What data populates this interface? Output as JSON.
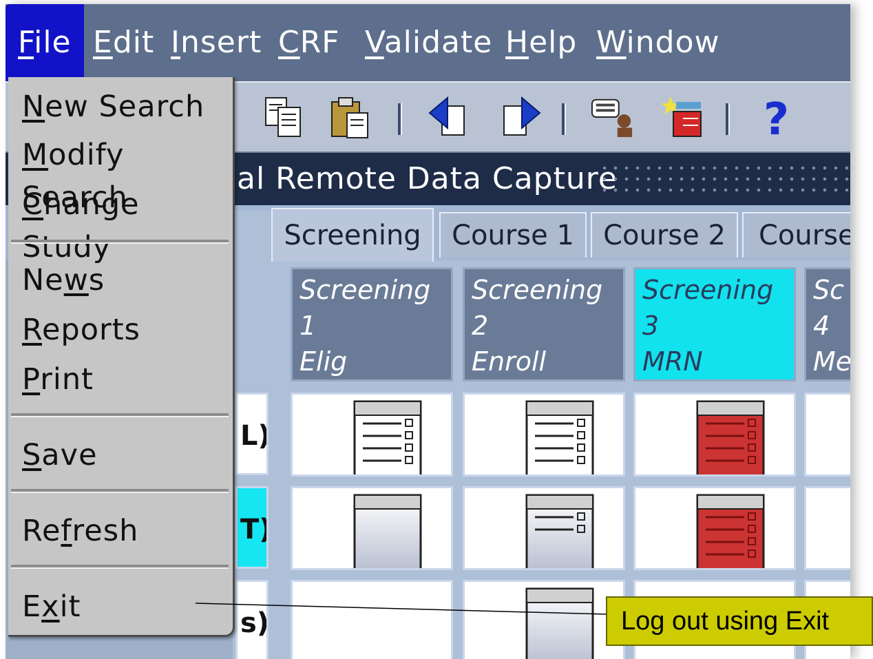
{
  "menubar": {
    "items": [
      "File",
      "Edit",
      "Insert",
      "CRF",
      "Validate",
      "Help",
      "Window"
    ],
    "active": "File"
  },
  "toolbar": {
    "icons": [
      "copy-icon",
      "paste-icon",
      "back-arrow-icon",
      "forward-arrow-icon",
      "comment-person-icon",
      "checklist-star-icon",
      "help-icon"
    ]
  },
  "title": {
    "text": "al Remote Data Capture"
  },
  "tabs": [
    "Screening",
    "Course 1",
    "Course 2",
    "Course"
  ],
  "selected_tab": "Screening",
  "columns": [
    {
      "line1": "Screening",
      "line2": "1",
      "line3": "Elig",
      "highlight": false
    },
    {
      "line1": "Screening",
      "line2": "2",
      "line3": "Enroll",
      "highlight": false
    },
    {
      "line1": "Screening",
      "line2": "3",
      "line3": "MRN",
      "highlight": true
    },
    {
      "line1": "Sc",
      "line2": "4",
      "line3": "Me",
      "highlight": false
    }
  ],
  "left_labels": [
    {
      "text": "L)",
      "highlight": false
    },
    {
      "text": "T)",
      "highlight": true
    },
    {
      "text": "s)",
      "highlight": false
    }
  ],
  "file_menu": {
    "items": [
      "New Search",
      "Modify Search",
      "Change Study",
      "News",
      "Reports",
      "Print",
      "Save",
      "Refresh",
      "Exit"
    ]
  },
  "callout": {
    "text": "Log out using Exit"
  },
  "colors": {
    "menubar": "#5d6f8c",
    "active_menu": "#1212c8",
    "highlight": "#12e2ee",
    "callout_bg": "#cccc00",
    "form_red": "#cc3333"
  }
}
